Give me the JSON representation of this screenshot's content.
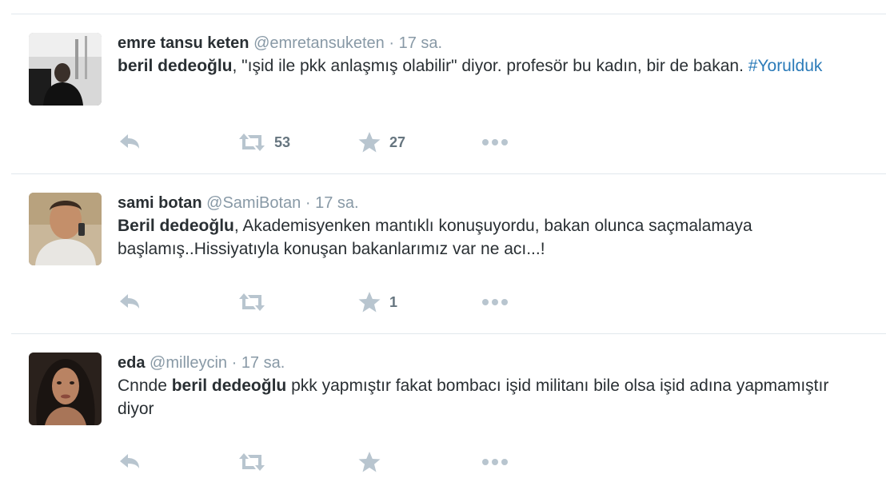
{
  "colors": {
    "text": "#292f33",
    "muted": "#8899a6",
    "link": "#2b7bb9",
    "action_icon": "#b8c5cf",
    "divider": "#e1e8ed"
  },
  "tweets": [
    {
      "name": "emre tansu keten",
      "handle": "@emretansuketen",
      "separator": "·",
      "time": "17 sa.",
      "avatar_icon": "avatar-photo",
      "body": {
        "mention": "beril dedeoğlu",
        "text": ", \"ışid ile pkk anlaşmış olabilir\" diyor. profesör bu kadın, bir de bakan. ",
        "hashtag": "#Yorulduk"
      },
      "retweets": "53",
      "favorites": "27"
    },
    {
      "name": "sami botan",
      "handle": "@SamiBotan",
      "separator": "·",
      "time": "17 sa.",
      "avatar_icon": "avatar-photo",
      "body": {
        "mention": "Beril dedeoğlu",
        "text": ", Akademisyenken mantıklı konuşuyordu, bakan olunca saçmalamaya başlamış..Hissiyatıyla konuşan bakanlarımız var ne acı...!"
      },
      "retweets": "",
      "favorites": "1"
    },
    {
      "name": "eda",
      "handle": "@milleycin",
      "separator": "·",
      "time": "17 sa.",
      "avatar_icon": "avatar-photo",
      "body": {
        "prefix": "Cnnde ",
        "mention": "beril dedeoğlu",
        "text": " pkk yapmıştır fakat bombacı işid militanı bile olsa işid adına yapmamıştır diyor"
      },
      "retweets": "",
      "favorites": ""
    }
  ]
}
